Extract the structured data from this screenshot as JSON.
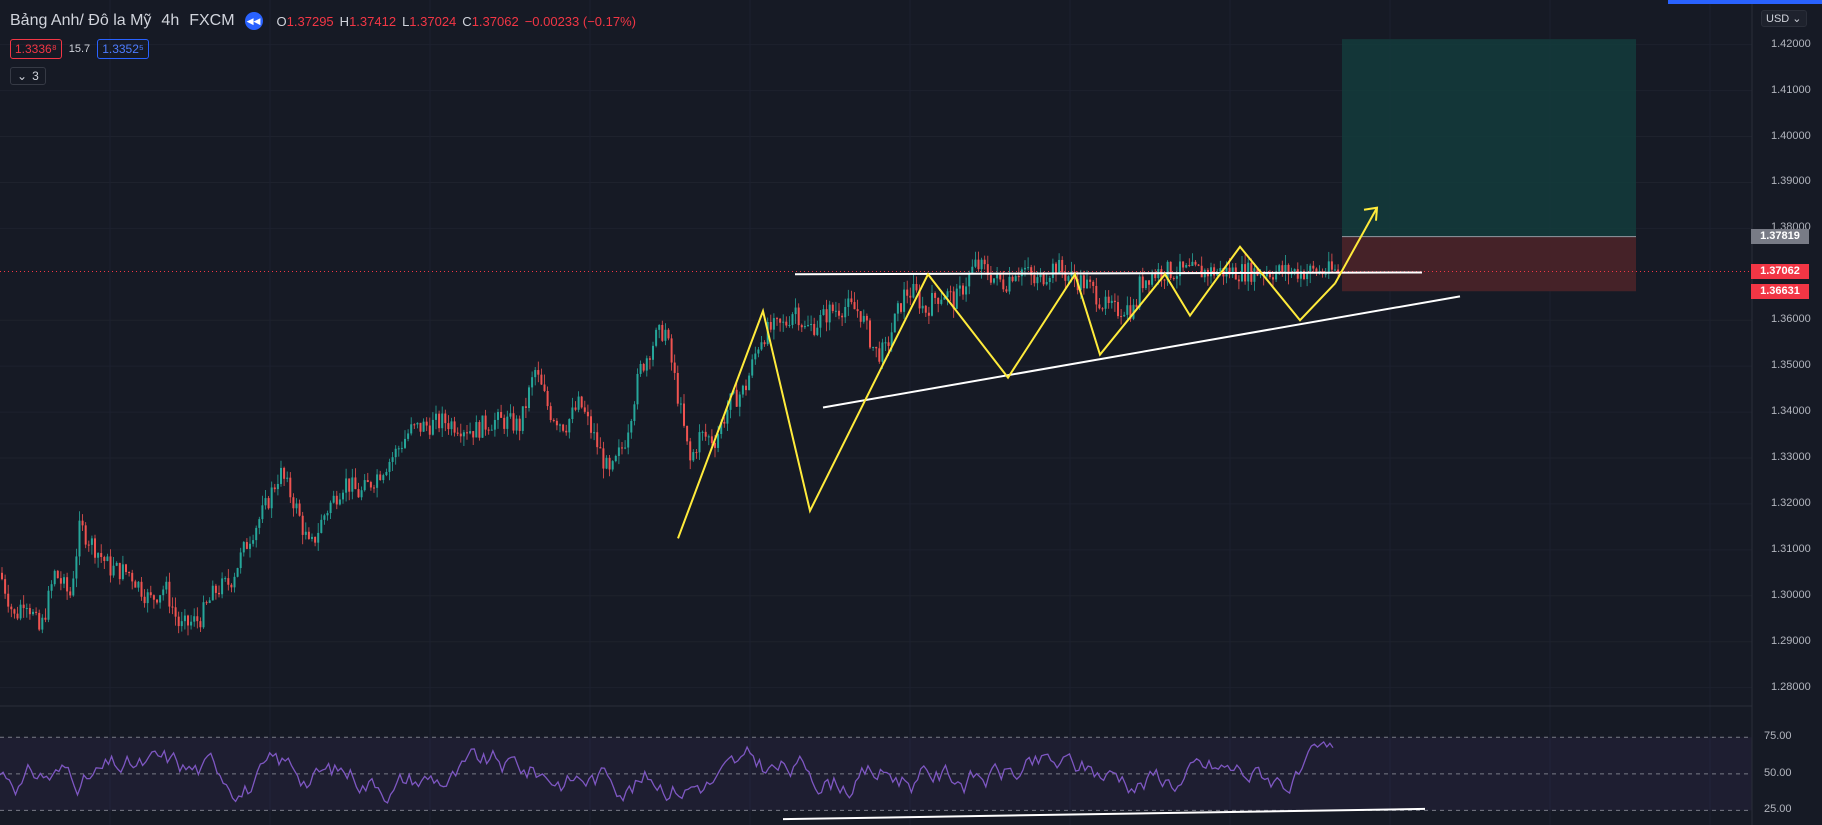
{
  "header": {
    "symbol": "Bảng Anh/ Đô la Mỹ",
    "timeframe": "4h",
    "exchange": "FXCM",
    "replay_icon": "rewind-icon",
    "open_key": "O",
    "open": "1.37295",
    "high_key": "H",
    "high": "1.37412",
    "low_key": "L",
    "low": "1.37024",
    "close_key": "C",
    "close": "1.37062",
    "change": "−0.00233 (−0.17%)"
  },
  "quotes": {
    "sell": "1.3336⁸",
    "spread": "15.7",
    "buy": "1.3352⁵"
  },
  "indicators_toggle": {
    "icon": "chevron-down-icon",
    "count": "3"
  },
  "currency_selector": "USD",
  "price_axis": {
    "labels": [
      "1.42000",
      "1.41000",
      "1.40000",
      "1.39000",
      "1.38000",
      "1.37819",
      "1.37062",
      "1.36631",
      "1.36000",
      "1.35000",
      "1.34000",
      "1.33000",
      "1.32000",
      "1.31000",
      "1.30000",
      "1.29000",
      "1.28000"
    ],
    "tags": [
      {
        "value": "1.37819",
        "color": "#787b86"
      },
      {
        "value": "1.37062",
        "color": "#f23645"
      },
      {
        "value": "1.36631",
        "color": "#f23645"
      }
    ]
  },
  "rsi_axis": {
    "labels": [
      "75.00",
      "50.00",
      "25.00"
    ]
  },
  "colors": {
    "background": "#161a25",
    "up": "#26a69a",
    "down": "#ef5350",
    "trendline": "#ffffff",
    "zigzag": "#ffeb3b",
    "target_zone": "#133c3c",
    "stop_zone": "#4a2329",
    "rsi_line": "#7e57c2"
  },
  "chart_data": {
    "type": "candlestick",
    "series": [
      {
        "name": "Bảng Anh/ Đô la Mỹ",
        "ohlc_last": {
          "open": 1.37295,
          "high": 1.37412,
          "low": 1.37024,
          "close": 1.37062
        }
      }
    ],
    "close_path": [
      [
        0,
        1.305
      ],
      [
        15,
        1.295
      ],
      [
        25,
        1.3
      ],
      [
        40,
        1.292
      ],
      [
        55,
        1.305
      ],
      [
        70,
        1.3
      ],
      [
        80,
        1.315
      ],
      [
        90,
        1.312
      ],
      [
        110,
        1.306
      ],
      [
        130,
        1.305
      ],
      [
        150,
        1.299
      ],
      [
        165,
        1.302
      ],
      [
        180,
        1.293
      ],
      [
        200,
        1.295
      ],
      [
        215,
        1.301
      ],
      [
        230,
        1.303
      ],
      [
        250,
        1.313
      ],
      [
        265,
        1.319
      ],
      [
        280,
        1.327
      ],
      [
        295,
        1.32
      ],
      [
        310,
        1.31
      ],
      [
        325,
        1.318
      ],
      [
        345,
        1.325
      ],
      [
        360,
        1.322
      ],
      [
        380,
        1.327
      ],
      [
        395,
        1.331
      ],
      [
        410,
        1.336
      ],
      [
        425,
        1.337
      ],
      [
        445,
        1.338
      ],
      [
        460,
        1.337
      ],
      [
        475,
        1.336
      ],
      [
        490,
        1.338
      ],
      [
        505,
        1.338
      ],
      [
        520,
        1.337
      ],
      [
        535,
        1.349
      ],
      [
        550,
        1.34
      ],
      [
        565,
        1.337
      ],
      [
        580,
        1.342
      ],
      [
        595,
        1.334
      ],
      [
        610,
        1.326
      ],
      [
        625,
        1.334
      ],
      [
        640,
        1.349
      ],
      [
        655,
        1.356
      ],
      [
        665,
        1.358
      ],
      [
        675,
        1.347
      ],
      [
        690,
        1.329
      ],
      [
        700,
        1.335
      ],
      [
        715,
        1.334
      ],
      [
        730,
        1.342
      ],
      [
        745,
        1.345
      ],
      [
        760,
        1.356
      ],
      [
        770,
        1.358
      ],
      [
        785,
        1.359
      ],
      [
        795,
        1.363
      ],
      [
        805,
        1.358
      ],
      [
        815,
        1.359
      ],
      [
        830,
        1.362
      ],
      [
        845,
        1.363
      ],
      [
        860,
        1.362
      ],
      [
        875,
        1.353
      ],
      [
        885,
        1.353
      ],
      [
        895,
        1.36
      ],
      [
        905,
        1.366
      ],
      [
        915,
        1.366
      ],
      [
        925,
        1.362
      ],
      [
        935,
        1.365
      ],
      [
        945,
        1.366
      ],
      [
        955,
        1.364
      ],
      [
        965,
        1.368
      ],
      [
        975,
        1.372
      ],
      [
        985,
        1.371
      ],
      [
        995,
        1.369
      ],
      [
        1005,
        1.368
      ],
      [
        1015,
        1.371
      ],
      [
        1025,
        1.371
      ],
      [
        1035,
        1.368
      ],
      [
        1045,
        1.37
      ],
      [
        1055,
        1.372
      ],
      [
        1065,
        1.37
      ],
      [
        1075,
        1.369
      ],
      [
        1085,
        1.368
      ],
      [
        1095,
        1.366
      ],
      [
        1105,
        1.363
      ],
      [
        1115,
        1.362
      ],
      [
        1125,
        1.363
      ],
      [
        1135,
        1.362
      ],
      [
        1140,
        1.368
      ],
      [
        1150,
        1.37
      ],
      [
        1160,
        1.3706
      ]
    ],
    "price_range": [
      1.276,
      1.4245
    ],
    "rsi": {
      "levels": [
        75,
        50,
        25
      ],
      "range": [
        15,
        95
      ]
    },
    "annotations": [
      "horizontal resistance at 1.3700",
      "rising support trendline 1.341 → 1.3625",
      "zig-zag price path with arrow to 1.3845",
      "long position: entry 1.37062, stop 1.36631, target 1.42120",
      "RSI rising support line"
    ]
  }
}
